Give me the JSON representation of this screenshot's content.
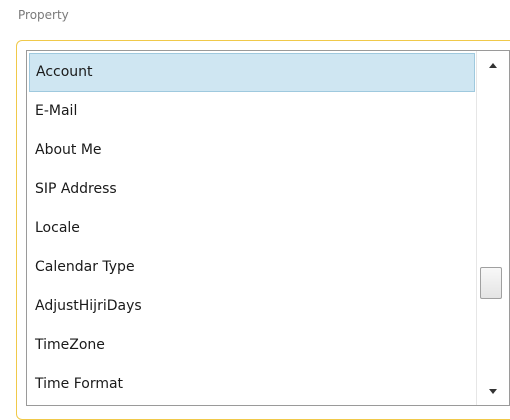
{
  "field": {
    "label": "Property"
  },
  "list": {
    "selected_index": 0,
    "items": [
      {
        "label": "Account"
      },
      {
        "label": "E-Mail"
      },
      {
        "label": "About Me"
      },
      {
        "label": "SIP Address"
      },
      {
        "label": "Locale"
      },
      {
        "label": "Calendar Type"
      },
      {
        "label": "AdjustHijriDays"
      },
      {
        "label": "TimeZone"
      },
      {
        "label": "Time Format"
      }
    ]
  },
  "scrollbar": {
    "up_icon": "triangle-up",
    "down_icon": "triangle-down"
  },
  "colors": {
    "selection_bg": "#cfe6f2",
    "focus_border": "#f0c94a"
  }
}
